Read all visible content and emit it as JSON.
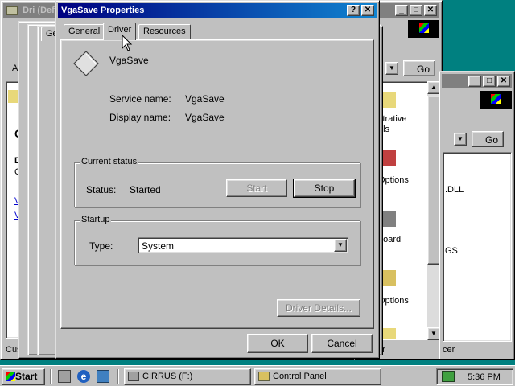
{
  "bg_windows": {
    "left_title": "Dri (Def",
    "left_toolbar_letter": "A",
    "left_content": {
      "letter_c": "C",
      "letter_d": "D",
      "letter_c2": "C",
      "link1": "V",
      "link2": "V"
    },
    "left_status": "Cus",
    "cp_go": "Go",
    "cp_items": [
      "strative",
      "ols",
      "Options",
      "board",
      "Options"
    ],
    "cp_status": "er",
    "right_go": "Go",
    "right_items": [
      ".DLL",
      "GS"
    ],
    "right_status": "cer"
  },
  "dialog": {
    "title": "VgaSave Properties",
    "tabs": [
      "General",
      "Driver",
      "Resources"
    ],
    "service_display": "VgaSave",
    "service_name_label": "Service name:",
    "service_name_value": "VgaSave",
    "display_name_label": "Display name:",
    "display_name_value": "VgaSave",
    "current_status_title": "Current status",
    "status_label": "Status:",
    "status_value": "Started",
    "start_button": "Start",
    "stop_button": "Stop",
    "startup_title": "Startup",
    "type_label": "Type:",
    "type_value": "System",
    "driver_details_button": "Driver Details...",
    "ok_button": "OK",
    "cancel_button": "Cancel"
  },
  "taskbar": {
    "start_label": "Start",
    "tasks": [
      "CIRRUS (F:)",
      "Control Panel"
    ],
    "clock": "5:36 PM"
  }
}
